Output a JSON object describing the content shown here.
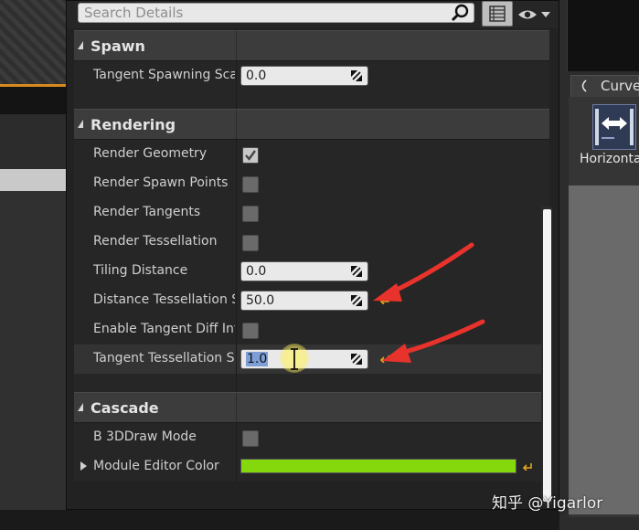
{
  "search": {
    "placeholder": "Search Details"
  },
  "icons": {
    "search": "magnifier-icon",
    "view_options": "grid-list-icon",
    "visibility": "eye-icon",
    "spinner": "drag-arrows-icon",
    "reset": "reset-to-default-icon"
  },
  "categories": {
    "spawn": "Spawn",
    "rendering": "Rendering",
    "cascade": "Cascade"
  },
  "spawn": {
    "tangent_spawning_scale": {
      "label": "Tangent Spawning Scal",
      "value": "0.0"
    }
  },
  "rendering": {
    "render_geometry": {
      "label": "Render Geometry",
      "checked": true
    },
    "render_spawn_points": {
      "label": "Render Spawn Points",
      "checked": false
    },
    "render_tangents": {
      "label": "Render Tangents",
      "checked": false
    },
    "render_tessellation": {
      "label": "Render Tessellation",
      "checked": false
    },
    "tiling_distance": {
      "label": "Tiling Distance",
      "value": "0.0"
    },
    "distance_tessellation": {
      "label": "Distance Tessellation S",
      "value": "50.0"
    },
    "enable_tangent_diff": {
      "label": "Enable Tangent Diff Inte",
      "checked": false
    },
    "tangent_tessellation": {
      "label": "Tangent Tessellation S",
      "value": "1.0"
    }
  },
  "cascade": {
    "b3d_draw_mode": {
      "label": "B 3DDraw Mode",
      "checked": false
    },
    "module_editor_color": {
      "label": "Module Editor Color",
      "color": "#84d80c"
    }
  },
  "right_panel": {
    "tab_label": "Curve",
    "tool_label": "Horizonta"
  },
  "colors": {
    "annotation_arrow": "#e8322c",
    "accent_orange": "#d98a1c",
    "color_swatch": "#84d80c"
  },
  "watermark": "知乎 @Yigarlor"
}
